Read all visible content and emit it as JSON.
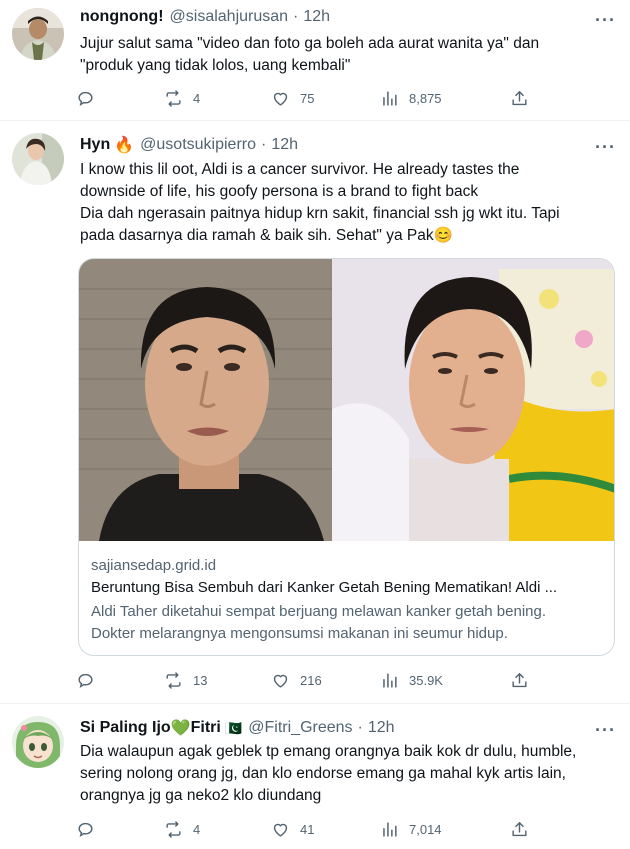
{
  "tweets": [
    {
      "name": "nongnong!",
      "handle": "@sisalahjurusan",
      "time": "12h",
      "lines": [
        "Jujur salut sama \"video dan foto ga boleh ada aurat wanita ya\" dan",
        "\"produk yang tidak lolos, uang kembali\""
      ],
      "retweets": "4",
      "likes": "75",
      "views": "8,875"
    },
    {
      "name": "Hyn",
      "name_emoji": "🔥",
      "handle": "@usotsukipierro",
      "time": "12h",
      "lines": [
        "I know this lil oot, Aldi is a cancer survivor. He already tastes the",
        "downside of life, his goofy persona is a brand to fight back",
        "Dia dah ngerasain paitnya hidup krn sakit, financial ssh jg wkt itu. Tapi",
        "pada dasarnya dia ramah & baik sih. Sehat\" ya Pak😊"
      ],
      "card": {
        "domain": "sajiansedap.grid.id",
        "title": "Beruntung Bisa Sembuh dari Kanker Getah Bening Mematikan! Aldi ...",
        "desc_lines": [
          "Aldi Taher diketahui sempat berjuang melawan kanker getah bening.",
          "Dokter melarangnya mengonsumsi makanan ini seumur hidup."
        ]
      },
      "retweets": "13",
      "likes": "216",
      "views": "35.9K"
    },
    {
      "name": "Si Paling Ijo",
      "name_emoji": "💚",
      "name_suffix": "Fitri",
      "flag": "🇵🇰",
      "handle": "@Fitri_Greens",
      "time": "12h",
      "lines": [
        "Dia walaupun agak geblek tp emang orangnya baik kok dr dulu, humble,",
        "sering nolong orang jg, dan klo endorse emang ga mahal kyk artis lain,",
        "orangnya jg ga neko2 klo diundang"
      ],
      "retweets": "4",
      "likes": "41",
      "views": "7,014"
    }
  ],
  "colors": {
    "text": "#0f1419",
    "secondary": "#536471",
    "border": "#cfd9de",
    "divider": "#eff3f4"
  },
  "icons": [
    "reply-icon",
    "retweet-icon",
    "like-icon",
    "views-icon",
    "share-icon",
    "more-icon"
  ]
}
